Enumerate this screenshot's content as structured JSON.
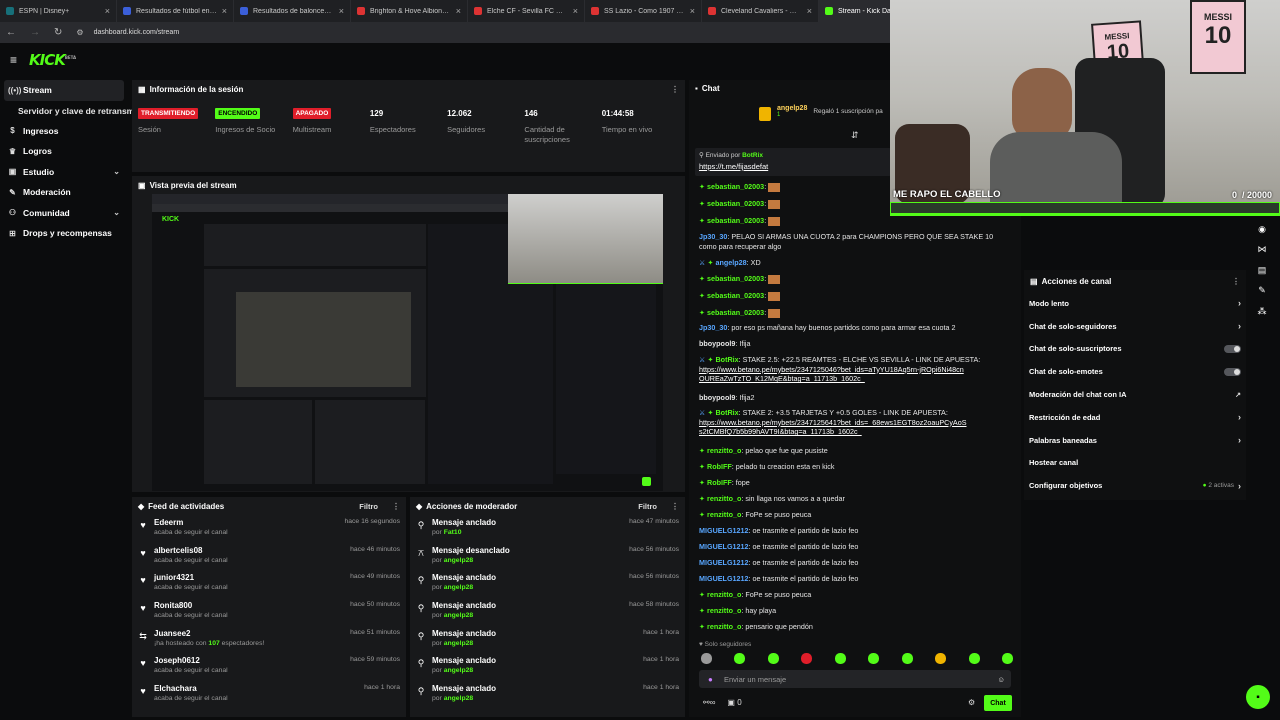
{
  "browser": {
    "tabs": [
      {
        "label": "ESPN | Disney+",
        "color": "#17707a"
      },
      {
        "label": "Resultados de fútbol en directo",
        "color": "#3b5fd9"
      },
      {
        "label": "Resultados de baloncesto en directo",
        "color": "#3b5fd9"
      },
      {
        "label": "Brighton & Hove Albion - AFC",
        "color": "#d33"
      },
      {
        "label": "Elche CF - Sevilla FC Cuotas",
        "color": "#d33"
      },
      {
        "label": "SS Lazio - Como 1907 Cuotas",
        "color": "#d33"
      },
      {
        "label": "Cleveland Cavaliers - Oklahoma",
        "color": "#d33"
      },
      {
        "label": "Stream - Kick Dashboard",
        "color": "#53fc18"
      }
    ],
    "url": "dashboard.kick.com/stream"
  },
  "brand": {
    "logo": "KICK",
    "beta": "BETA",
    "accent": "#53fc18"
  },
  "sidebar": {
    "items": [
      {
        "label": "Stream",
        "icon": "broadcast-icon"
      },
      {
        "label": "Servidor y clave de retransmisión"
      },
      {
        "label": "Ingresos",
        "icon": "dollar-icon"
      },
      {
        "label": "Logros",
        "icon": "trophy-icon"
      },
      {
        "label": "Estudio",
        "icon": "studio-icon"
      },
      {
        "label": "Moderación",
        "icon": "wrench-icon"
      },
      {
        "label": "Comunidad",
        "icon": "people-icon"
      },
      {
        "label": "Drops y recompensas",
        "icon": "gift-icon"
      }
    ]
  },
  "session": {
    "title": "Información de la sesión",
    "stats": [
      {
        "value": "TRANSMITIENDO",
        "label": "Sesión",
        "badge": "#e01e2a"
      },
      {
        "value": "ENCENDIDO",
        "label": "Ingresos de Socio",
        "badge": "#53fc18"
      },
      {
        "value": "APAGADO",
        "label": "Multistream",
        "badge": "#e01e2a"
      },
      {
        "value": "129",
        "label": "Espectadores"
      },
      {
        "value": "12.062",
        "label": "Seguidores"
      },
      {
        "value": "146",
        "label": "Cantidad de suscripciones"
      },
      {
        "value": "01:44:58",
        "label": "Tiempo en vivo"
      }
    ]
  },
  "preview": {
    "title": "Vista previa del stream"
  },
  "feed": {
    "title": "Feed de actividades",
    "filter": "Filtro",
    "rows": [
      {
        "name": "Edeerm",
        "desc": "acaba de seguir el canal",
        "time": "hace 16 segundos",
        "icon": "heart-icon"
      },
      {
        "name": "albertcelis08",
        "desc": "acaba de seguir el canal",
        "time": "hace 46 minutos",
        "icon": "heart-icon"
      },
      {
        "name": "junior4321",
        "desc": "acaba de seguir el canal",
        "time": "hace 49 minutos",
        "icon": "heart-icon"
      },
      {
        "name": "Ronita800",
        "desc": "acaba de seguir el canal",
        "time": "hace 50 minutos",
        "icon": "heart-icon"
      },
      {
        "name": "Juansee2",
        "desc": "¡ha hosteado con",
        "count": "107",
        "desc2": "espectadores!",
        "time": "hace 51 minutos",
        "icon": "host-icon"
      },
      {
        "name": "Joseph0612",
        "desc": "acaba de seguir el canal",
        "time": "hace 59 minutos",
        "icon": "heart-icon"
      },
      {
        "name": "Elchachara",
        "desc": "acaba de seguir el canal",
        "time": "hace 1 hora",
        "icon": "heart-icon"
      }
    ]
  },
  "mod": {
    "title": "Acciones de moderador",
    "filter": "Filtro",
    "rows": [
      {
        "name": "Mensaje anclado",
        "by": "por",
        "user": "Fat10",
        "time": "hace 47 minutos",
        "icon": "pin-icon"
      },
      {
        "name": "Mensaje desanclado",
        "by": "por",
        "user": "angelp28",
        "time": "hace 56 minutos",
        "icon": "unpin-icon"
      },
      {
        "name": "Mensaje anclado",
        "by": "por",
        "user": "angelp28",
        "time": "hace 56 minutos",
        "icon": "pin-icon"
      },
      {
        "name": "Mensaje anclado",
        "by": "por",
        "user": "angelp28",
        "time": "hace 58 minutos",
        "icon": "pin-icon"
      },
      {
        "name": "Mensaje anclado",
        "by": "por",
        "user": "angelp28",
        "time": "hace 1 hora",
        "icon": "pin-icon"
      },
      {
        "name": "Mensaje anclado",
        "by": "por",
        "user": "angelp28",
        "time": "hace 1 hora",
        "icon": "pin-icon"
      },
      {
        "name": "Mensaje anclado",
        "by": "por",
        "user": "angelp28",
        "time": "hace 1 hora",
        "icon": "pin-icon"
      }
    ]
  },
  "chat": {
    "title": "Chat",
    "gifter": "angelp28",
    "gift_count": "1",
    "gift_text": "Regaló 1 suscripción pa",
    "pinned_label": "Enviado por",
    "pinned_user": "BotRix",
    "pinned_link": "https://t.me/fijasdefat",
    "messages": [
      {
        "u": "sebastian_02003",
        "t": ":",
        "c": "g"
      },
      {
        "u": "sebastian_02003",
        "t": ":",
        "c": "g"
      },
      {
        "u": "sebastian_02003",
        "t": ":",
        "c": "g"
      },
      {
        "u": "Jp30_30",
        "t": ": PELAO SI ARMAS UNA CUOTA 2 para CHAMPIONS PERO QUE SEA STAKE 10 como para recuperar algo",
        "c": "b"
      },
      {
        "u": "angelp28",
        "t": ": XD",
        "c": "b"
      },
      {
        "u": "sebastian_02003",
        "t": ":",
        "c": "g"
      },
      {
        "u": "sebastian_02003",
        "t": ":",
        "c": "g"
      },
      {
        "u": "sebastian_02003",
        "t": ":",
        "c": "g"
      },
      {
        "u": "Jp30_30",
        "t": ": por eso ps mañana hay buenos partidos como para armar esa cuota 2",
        "c": "b"
      },
      {
        "u": "bboypool9",
        "t": ": Ifija",
        "c": "w"
      },
      {
        "u": "BotRix",
        "t": ": STAKE 2.5: +22.5 REAMTES - ELCHE VS SEVILLA - LINK DE APUESTA:",
        "link": "https://www.betano.pe/mybets/2347125046?bet_ids=aTyYU18Aq5rn-jROpi6Ni48cnOUREaZwTzTO_K12MqE&btag=a_11713b_1602c_",
        "c": "g"
      },
      {
        "u": "bboypool9",
        "t": ": Ifija2",
        "c": "w"
      },
      {
        "u": "BotRix",
        "t": ": STAKE 2: +3.5 TARJETAS Y +0.5 GOLES - LINK DE APUESTA:",
        "link": "https://www.betano.pe/mybets/2347125641?bet_ids=_68ews1EGT8oz2oauPCyAoSs2tCMBfQ7b5b99hAVT9I&btag=a_11713b_1602c_",
        "c": "g"
      },
      {
        "u": "renzitto_o",
        "t": ": pelao que fue que pusiste",
        "c": "g"
      },
      {
        "u": "RobIFF",
        "t": ": pelado tu creacion esta en kick",
        "c": "g"
      },
      {
        "u": "RobIFF",
        "t": ": fope",
        "c": "g"
      },
      {
        "u": "renzitto_o",
        "t": ": sin llaga nos vamos a a quedar",
        "c": "g"
      },
      {
        "u": "renzitto_o",
        "t": ": FoPe se puso peuca",
        "c": "g"
      },
      {
        "u": "MIGUELG1212",
        "t": ": oe trasmite el partido de lazio feo",
        "c": "b"
      },
      {
        "u": "MIGUELG1212",
        "t": ": oe trasmite el partido de lazio feo",
        "c": "b"
      },
      {
        "u": "MIGUELG1212",
        "t": ": oe trasmite el partido de lazio feo",
        "c": "b"
      },
      {
        "u": "MIGUELG1212",
        "t": ": oe trasmite el partido de lazio feo",
        "c": "b"
      },
      {
        "u": "renzitto_o",
        "t": ": FoPe se puso peuca",
        "c": "g"
      },
      {
        "u": "renzitto_o",
        "t": ": hay playa",
        "c": "g"
      },
      {
        "u": "renzitto_o",
        "t": ": pensario que pendón",
        "c": "g"
      }
    ],
    "followers_only": "Solo seguidores",
    "input_placeholder": "Enviar un mensaje",
    "counter": "0",
    "send_label": "Chat"
  },
  "channel_actions": {
    "title": "Acciones de canal",
    "items": [
      {
        "label": "Modo lento",
        "ctrl": "chevron"
      },
      {
        "label": "Chat de solo-seguidores",
        "ctrl": "chevron"
      },
      {
        "label": "Chat de solo-suscriptores",
        "ctrl": "toggle"
      },
      {
        "label": "Chat de solo-emotes",
        "ctrl": "toggle"
      },
      {
        "label": "Moderación del chat con IA",
        "ctrl": "external"
      },
      {
        "label": "Restricción de edad",
        "ctrl": "chevron"
      },
      {
        "label": "Palabras baneadas",
        "ctrl": "chevron"
      },
      {
        "label": "Hostear canal",
        "ctrl": "none"
      },
      {
        "label": "Configurar objetivos",
        "ctrl": "chevron",
        "extra": "2 activas"
      }
    ]
  },
  "webcam": {
    "caption": "ME RAPO EL CABELLO",
    "goal": "0  / 20000",
    "poster1": "MESSI",
    "poster1_num": "10",
    "poster2": "MESSI",
    "poster2_num": "10"
  }
}
